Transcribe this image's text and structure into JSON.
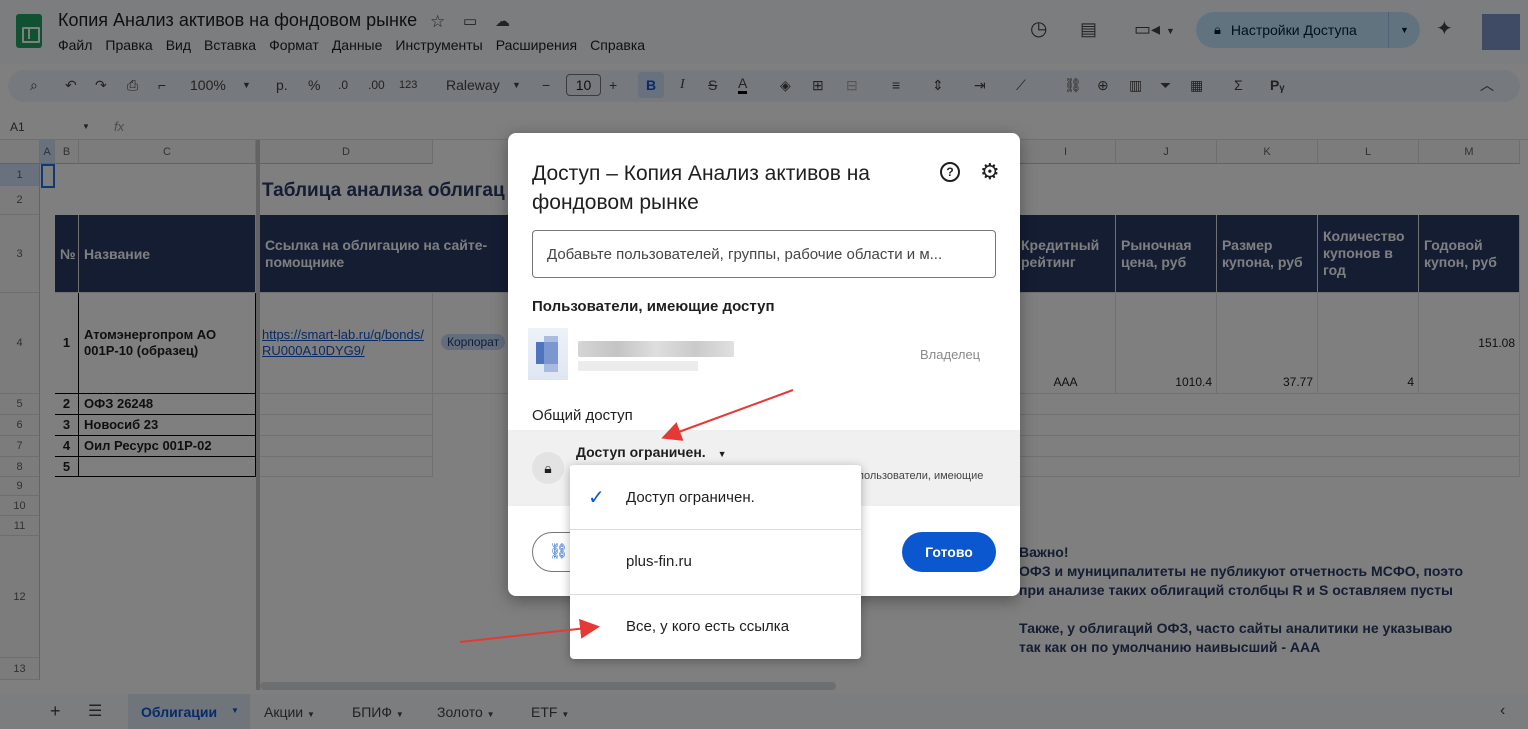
{
  "doc": {
    "title": "Копия Анализ активов на фондовом рынке",
    "menu": [
      "Файл",
      "Правка",
      "Вид",
      "Вставка",
      "Формат",
      "Данные",
      "Инструменты",
      "Расширения",
      "Справка"
    ],
    "share_label": "Настройки Доступа"
  },
  "toolbar": {
    "zoom": "100%",
    "currency": "р.",
    "percent": "%",
    "dec_dec": ".0",
    "inc_dec": ".00",
    "format_num": "123",
    "font": "Raleway",
    "font_size": "10",
    "bold": "B",
    "italic": "I",
    "strike": "S",
    "textcolor": "A",
    "sigma": "Σ"
  },
  "formula_bar": {
    "cell_ref": "A1",
    "fx": "fx"
  },
  "columns": [
    "A",
    "B",
    "C",
    "D",
    "I",
    "J",
    "K",
    "L",
    "M"
  ],
  "rows": [
    "1",
    "2",
    "3",
    "4",
    "5",
    "6",
    "7",
    "8",
    "9",
    "10",
    "11",
    "12",
    "13"
  ],
  "sheet": {
    "table_title": "Таблица анализа облигац",
    "headers": {
      "num": "№",
      "name": "Название",
      "link": "Ссылка на облигацию на сайте-помощнике",
      "rating": "Кредитный рейтинг",
      "price": "Рыночная цена, руб",
      "coupon_size": "Размер купона, руб",
      "coupon_count": "Количество купонов в год",
      "coupon_year": "Годовой купон, руб"
    },
    "rows": [
      {
        "n": "1",
        "name": "Атомэнергопром АО 001Р-10 (образец)",
        "link": "https://smart-lab.ru/q/bonds/RU000A10DYG9/",
        "type": "Корпорат",
        "rating": "AAA",
        "price": "1010.4",
        "coupon": "37.77",
        "count": "4",
        "year": "151.08"
      },
      {
        "n": "2",
        "name": "ОФЗ 26248"
      },
      {
        "n": "3",
        "name": "Новосиб 23"
      },
      {
        "n": "4",
        "name": "Оил Ресурс 001Р-02"
      },
      {
        "n": "5",
        "name": ""
      }
    ],
    "note": {
      "title": "Важно!",
      "l1": "ОФЗ и муниципалитеты не публикуют отчетность МСФО, поэто",
      "l2": "при анализе таких облигаций столбцы R и S оставляем пусты",
      "l3": "Также, у облигаций ОФЗ, часто сайты аналитики не указываю",
      "l4": "так как он по умолчанию наивысший - AAA"
    }
  },
  "tabs": [
    "Облигации",
    "Акции",
    "БПИФ",
    "Золото",
    "ETF"
  ],
  "dialog": {
    "title": "Доступ – Копия Анализ активов на фондовом рынке",
    "input_placeholder": "Добавьте пользователей, группы, рабочие области и м...",
    "users_heading": "Пользователи, имеющие доступ",
    "owner_role": "Владелец",
    "general_heading": "Общий доступ",
    "access_value": "Доступ ограничен.",
    "access_desc": "пользователи, имеющие",
    "done": "Готово"
  },
  "dropdown": {
    "options": [
      "Доступ ограничен.",
      "plus-fin.ru",
      "Все, у кого есть ссылка"
    ],
    "selected": "Доступ ограничен."
  },
  "colors": {
    "accent": "#0b57d0",
    "header_bg": "#2b3a67",
    "arrow": "#e53935"
  }
}
